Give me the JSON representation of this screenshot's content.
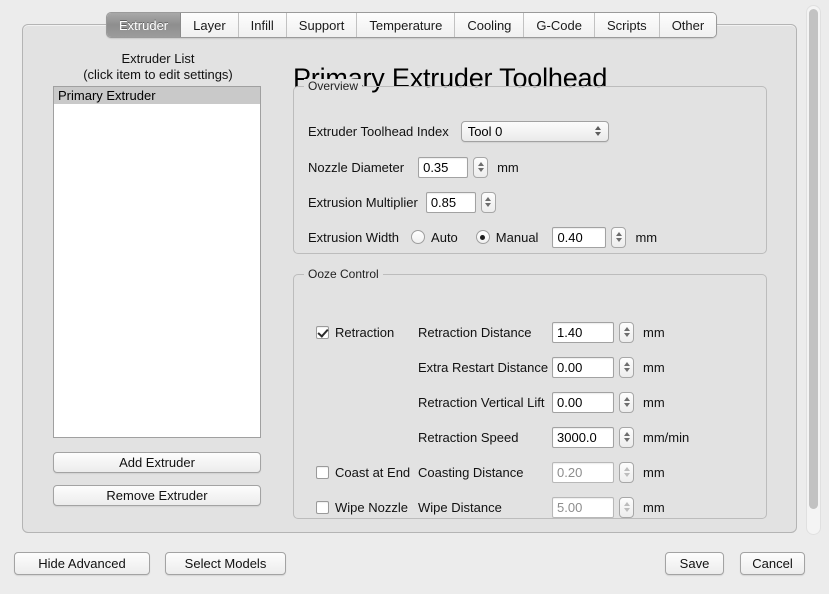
{
  "tabs": [
    {
      "label": "Extruder",
      "active": true
    },
    {
      "label": "Layer",
      "active": false
    },
    {
      "label": "Infill",
      "active": false
    },
    {
      "label": "Support",
      "active": false
    },
    {
      "label": "Temperature",
      "active": false
    },
    {
      "label": "Cooling",
      "active": false
    },
    {
      "label": "G-Code",
      "active": false
    },
    {
      "label": "Scripts",
      "active": false
    },
    {
      "label": "Other",
      "active": false
    }
  ],
  "sidebar": {
    "header_line1": "Extruder List",
    "header_line2": "(click item to edit settings)",
    "items": [
      {
        "label": "Primary Extruder",
        "selected": true
      }
    ],
    "add_button": "Add Extruder",
    "remove_button": "Remove Extruder"
  },
  "main": {
    "title": "Primary Extruder Toolhead",
    "overview": {
      "group_label": "Overview",
      "toolhead_index_label": "Extruder Toolhead Index",
      "toolhead_index_value": "Tool 0",
      "nozzle_diameter_label": "Nozzle Diameter",
      "nozzle_diameter_value": "0.35",
      "nozzle_diameter_unit": "mm",
      "extrusion_multiplier_label": "Extrusion Multiplier",
      "extrusion_multiplier_value": "0.85",
      "extrusion_width_label": "Extrusion Width",
      "extrusion_width_auto_label": "Auto",
      "extrusion_width_manual_label": "Manual",
      "extrusion_width_mode": "Manual",
      "extrusion_width_value": "0.40",
      "extrusion_width_unit": "mm"
    },
    "ooze": {
      "group_label": "Ooze Control",
      "retraction_label": "Retraction",
      "retraction_checked": true,
      "retraction_distance_label": "Retraction Distance",
      "retraction_distance_value": "1.40",
      "retraction_distance_unit": "mm",
      "extra_restart_label": "Extra Restart Distance",
      "extra_restart_value": "0.00",
      "extra_restart_unit": "mm",
      "vertical_lift_label": "Retraction Vertical Lift",
      "vertical_lift_value": "0.00",
      "vertical_lift_unit": "mm",
      "retraction_speed_label": "Retraction Speed",
      "retraction_speed_value": "3000.0",
      "retraction_speed_unit": "mm/min",
      "coast_at_end_label": "Coast at End",
      "coast_at_end_checked": false,
      "coasting_distance_label": "Coasting Distance",
      "coasting_distance_value": "0.20",
      "coasting_distance_unit": "mm",
      "wipe_nozzle_label": "Wipe Nozzle",
      "wipe_nozzle_checked": false,
      "wipe_distance_label": "Wipe Distance",
      "wipe_distance_value": "5.00",
      "wipe_distance_unit": "mm"
    }
  },
  "footer": {
    "hide_advanced": "Hide Advanced",
    "select_models": "Select Models",
    "save": "Save",
    "cancel": "Cancel"
  },
  "colors": {
    "window_bg": "#ececec",
    "panel_bg": "#e2e2e2",
    "selection": "#c9c9c9",
    "active_tab": "#9c9c9c"
  }
}
